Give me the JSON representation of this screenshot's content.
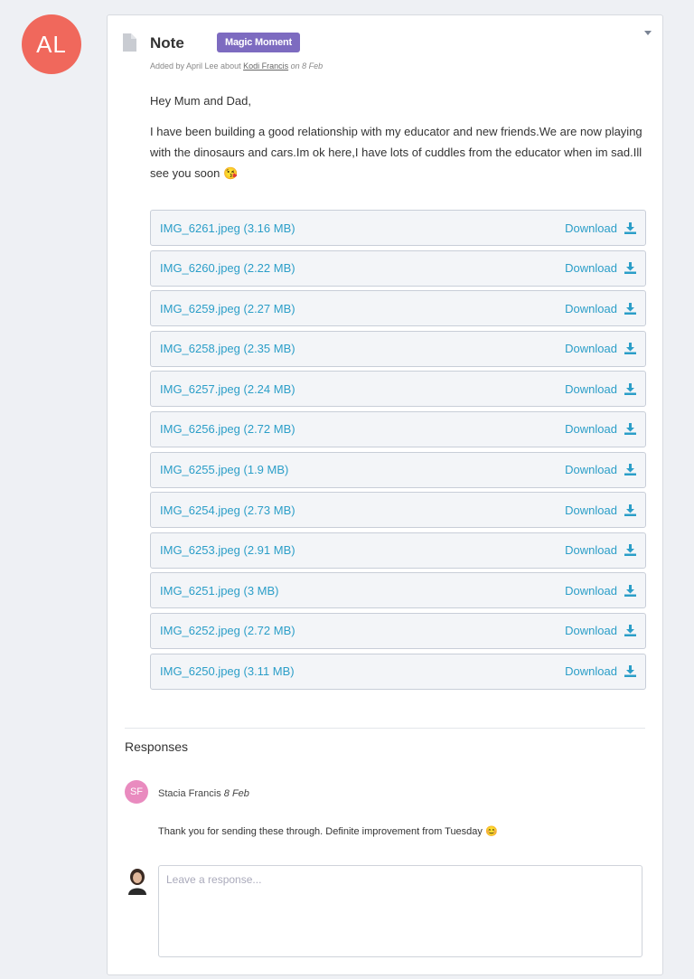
{
  "author_avatar": {
    "initials": "AL",
    "color": "#f0685c"
  },
  "note": {
    "type_label": "Note",
    "badge": "Magic Moment",
    "badge_color": "#7d6bc0",
    "meta_prefix": "Added by April Lee about",
    "meta_child": "Kodi Francis",
    "meta_date": "on 8 Feb",
    "greeting": "Hey Mum and Dad,",
    "body": "I have been building a good relationship with my educator and new friends.We are now playing with the dinosaurs and cars.Im ok here,I have lots of cuddles from the educator when im sad.Ill see you soon 😘"
  },
  "download_label": "Download",
  "accent_color": "#2b9ec8",
  "files": [
    {
      "name": "IMG_6261.jpeg (3.16 MB)"
    },
    {
      "name": "IMG_6260.jpeg (2.22 MB)"
    },
    {
      "name": "IMG_6259.jpeg (2.27 MB)"
    },
    {
      "name": "IMG_6258.jpeg (2.35 MB)"
    },
    {
      "name": "IMG_6257.jpeg (2.24 MB)"
    },
    {
      "name": "IMG_6256.jpeg (2.72 MB)"
    },
    {
      "name": "IMG_6255.jpeg (1.9 MB)"
    },
    {
      "name": "IMG_6254.jpeg (2.73 MB)"
    },
    {
      "name": "IMG_6253.jpeg (2.91 MB)"
    },
    {
      "name": "IMG_6251.jpeg (3 MB)"
    },
    {
      "name": "IMG_6252.jpeg (2.72 MB)"
    },
    {
      "name": "IMG_6250.jpeg (3.11 MB)"
    }
  ],
  "responses": {
    "heading": "Responses",
    "items": [
      {
        "initials": "SF",
        "author": "Stacia Francis",
        "date": "8 Feb",
        "text": "Thank you for sending these through. Definite improvement from Tuesday 😊"
      }
    ],
    "input_placeholder": "Leave a response..."
  }
}
